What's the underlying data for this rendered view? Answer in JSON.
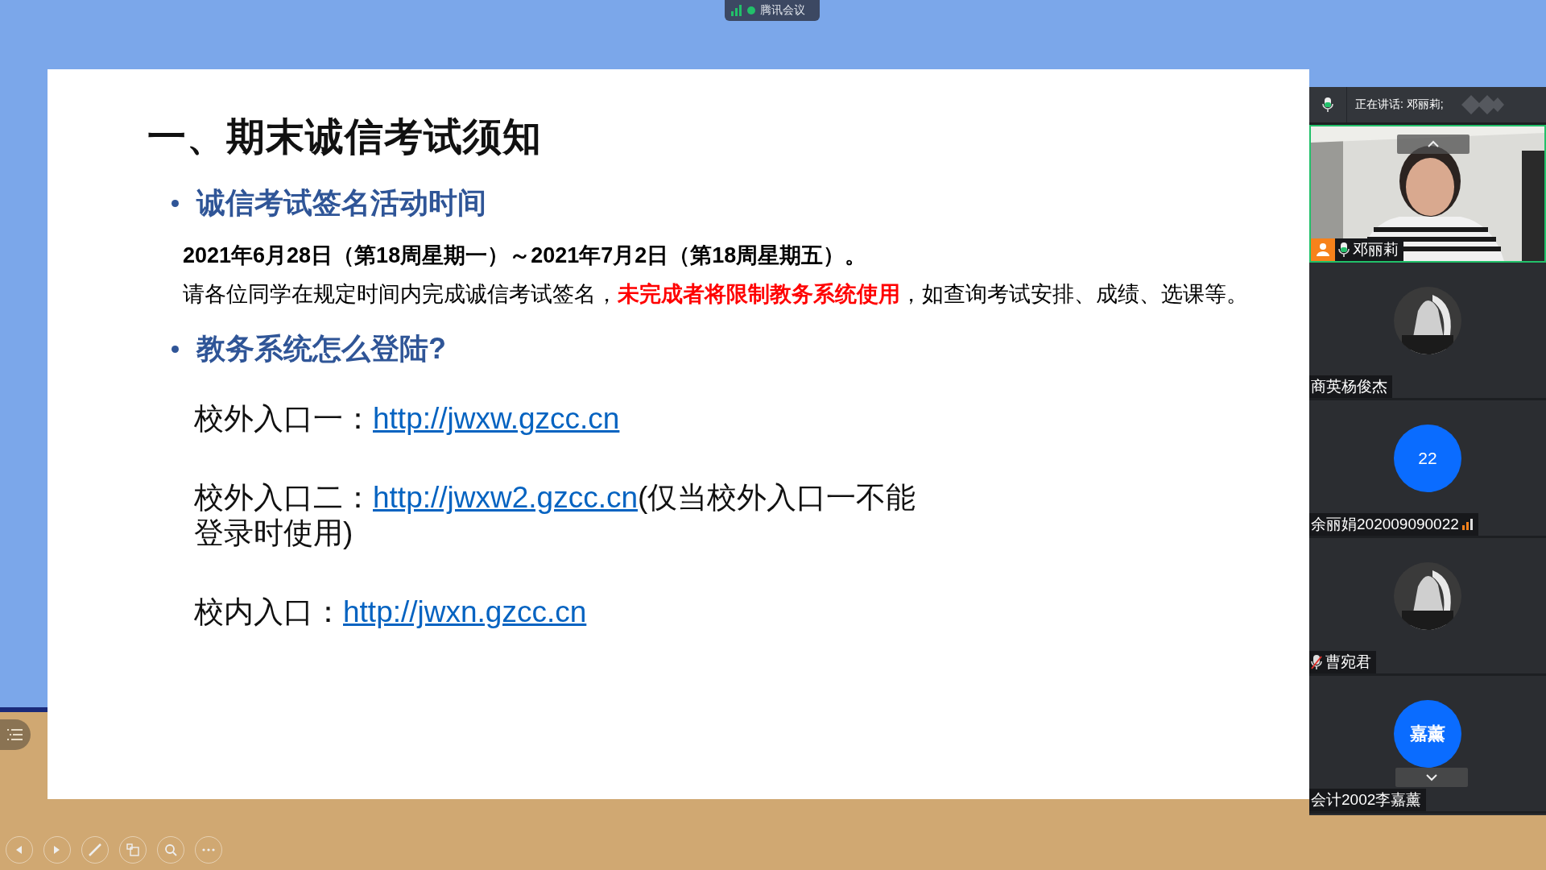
{
  "app_bar": {
    "title": "腾讯会议"
  },
  "slide": {
    "title": "一、期末诚信考试须知",
    "sections": [
      {
        "heading": "诚信考试签名活动时间",
        "items": [
          {
            "kind": "date",
            "text": "**2021年6月28日（第18周星期一）～2021年7月2日（第18周星期五）。**"
          },
          {
            "kind": "notice",
            "text": "请各位同学在规定时间内完成诚信考试签名，**未完成者将限制教务系统使用**，如查询考试安排、成绩、选课等。"
          }
        ]
      },
      {
        "heading": "教务系统怎么登陆?",
        "items": [
          {
            "kind": "link",
            "label": "校外入口一：",
            "url": "http://jwxw.gzcc.cn"
          },
          {
            "kind": "link",
            "label": "校外入口二：",
            "url": "http://jwxw2.gzcc.cn",
            "note": "(仅当校外入口一不能登录时使用)"
          },
          {
            "kind": "link",
            "label": "校内入口：",
            "url": "http://jwxn.gzcc.cn"
          }
        ]
      }
    ]
  },
  "meeting_panel": {
    "speaking_label": "正在讲话: 邓丽莉;",
    "participants": [
      {
        "name": "邓丽莉",
        "kind": "video",
        "speaking": true,
        "host": true,
        "mic_on": true,
        "muted": false,
        "signal": false
      },
      {
        "name": "商英杨俊杰",
        "kind": "picture",
        "speaking": false,
        "host": false,
        "mic_on": false,
        "muted": false,
        "signal": false
      },
      {
        "name": "余丽娟202009090022",
        "kind": "initials",
        "initials": "22",
        "speaking": false,
        "host": false,
        "mic_on": false,
        "muted": false,
        "signal": true
      },
      {
        "name": "曹宛君",
        "kind": "picture",
        "speaking": false,
        "host": false,
        "mic_on": false,
        "muted": true,
        "signal": false
      },
      {
        "name": "会计2002李嘉薰",
        "kind": "initials",
        "initials": "嘉薰",
        "speaking": false,
        "host": false,
        "mic_on": false,
        "muted": false,
        "signal": false
      }
    ]
  }
}
